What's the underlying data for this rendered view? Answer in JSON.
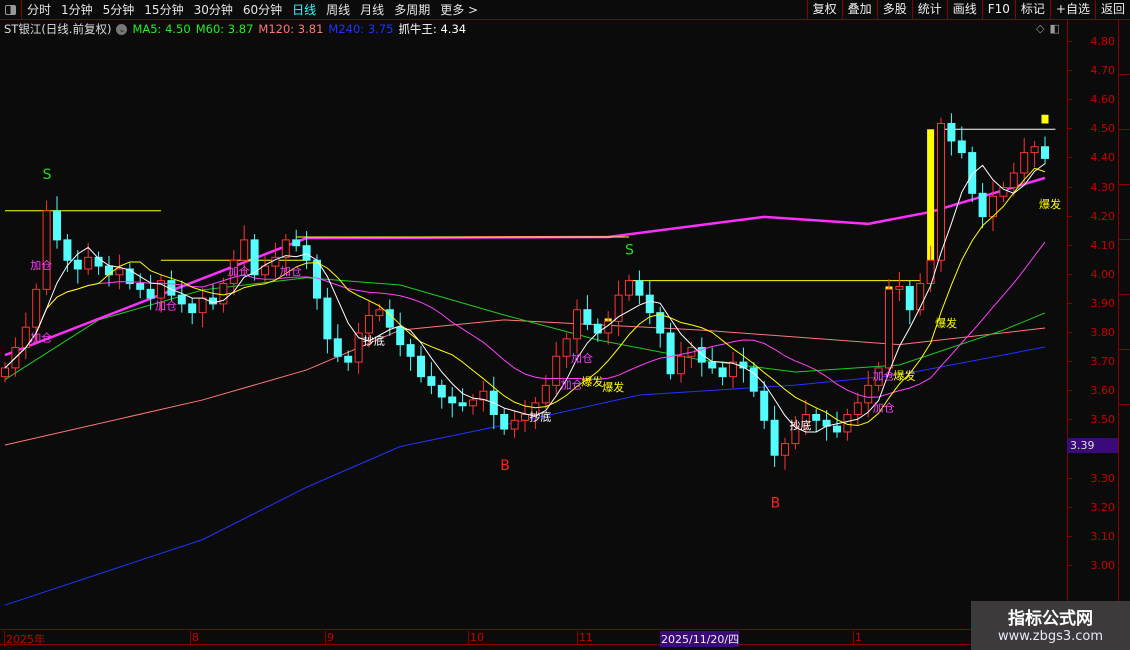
{
  "toolbar": {
    "periods": [
      "分时",
      "1分钟",
      "5分钟",
      "15分钟",
      "30分钟",
      "60分钟",
      "日线",
      "周线",
      "月线",
      "多周期",
      "更多 >"
    ],
    "active": "日线",
    "right_buttons": [
      "复权",
      "叠加",
      "多股",
      "统计",
      "画线",
      "F10",
      "标记",
      "+自选",
      "返回"
    ]
  },
  "info": {
    "title": "ST银江(日线.前复权)",
    "ma5": "MA5: 4.50",
    "m60": "M60: 3.87",
    "m120": "M120: 3.81",
    "m240": "M240: 3.75",
    "zhua": "抓牛王: 4.34"
  },
  "colors": {
    "up": "#ff3232",
    "down": "#54fcfc",
    "ma5": "#ffffff",
    "ma10": "#ffff00",
    "ma20": "#ff40ff",
    "m60": "#22cc22",
    "m120": "#ff7777",
    "m240": "#2233ff",
    "trend": "#ff30ff"
  },
  "price_axis": {
    "ticks": [
      "4.80",
      "4.70",
      "4.60",
      "4.50",
      "4.40",
      "4.30",
      "4.20",
      "4.10",
      "4.00",
      "3.90",
      "3.80",
      "3.70",
      "3.60",
      "3.50",
      "3.40",
      "3.30",
      "3.20",
      "3.10",
      "3.00"
    ],
    "current": "3.39",
    "max": 4.8,
    "min": 3.0
  },
  "date_axis": [
    "2025年",
    "8",
    "9",
    "10",
    "11",
    "2025/11/20/四",
    "1"
  ],
  "watermark": {
    "title": "指标公式网",
    "url": "www.zbgs3.com"
  },
  "chart_data": {
    "type": "candlestick",
    "closes": [
      3.68,
      3.75,
      3.82,
      3.95,
      4.22,
      4.12,
      4.05,
      4.02,
      4.06,
      4.03,
      4.0,
      4.02,
      3.97,
      3.95,
      3.92,
      3.98,
      3.93,
      3.9,
      3.87,
      3.92,
      3.9,
      3.97,
      4.05,
      4.12,
      4.0,
      4.03,
      4.06,
      4.12,
      4.1,
      4.05,
      3.92,
      3.78,
      3.72,
      3.7,
      3.8,
      3.86,
      3.88,
      3.82,
      3.76,
      3.72,
      3.65,
      3.62,
      3.58,
      3.56,
      3.55,
      3.57,
      3.6,
      3.52,
      3.47,
      3.5,
      3.52,
      3.56,
      3.62,
      3.72,
      3.78,
      3.88,
      3.83,
      3.8,
      3.84,
      3.93,
      3.98,
      3.93,
      3.87,
      3.8,
      3.66,
      3.72,
      3.75,
      3.7,
      3.68,
      3.65,
      3.7,
      3.68,
      3.6,
      3.5,
      3.38,
      3.42,
      3.48,
      3.52,
      3.5,
      3.48,
      3.46,
      3.52,
      3.56,
      3.62,
      3.68,
      3.95,
      3.96,
      3.88,
      3.97,
      4.05,
      4.52,
      4.46,
      4.42,
      4.28,
      4.2,
      4.27,
      4.3,
      4.35,
      4.42,
      4.44,
      4.4
    ],
    "lines": {
      "m240": [
        [
          0,
          2.865
        ],
        [
          19,
          3.09
        ],
        [
          29,
          3.27
        ],
        [
          38,
          3.41
        ],
        [
          48,
          3.484
        ],
        [
          61,
          3.587
        ],
        [
          76,
          3.621
        ],
        [
          86,
          3.656
        ],
        [
          100,
          3.752
        ]
      ],
      "m120": [
        [
          0,
          3.415
        ],
        [
          19,
          3.57
        ],
        [
          29,
          3.673
        ],
        [
          38,
          3.81
        ],
        [
          48,
          3.845
        ],
        [
          67,
          3.81
        ],
        [
          86,
          3.76
        ],
        [
          100,
          3.817
        ]
      ],
      "m60": [
        [
          0,
          3.64
        ],
        [
          9,
          3.845
        ],
        [
          19,
          3.948
        ],
        [
          29,
          3.99
        ],
        [
          38,
          3.965
        ],
        [
          48,
          3.862
        ],
        [
          57,
          3.776
        ],
        [
          67,
          3.707
        ],
        [
          76,
          3.666
        ],
        [
          86,
          3.69
        ],
        [
          96,
          3.81
        ],
        [
          100,
          3.869
        ]
      ],
      "trend": [
        [
          0,
          3.724
        ],
        [
          29,
          4.126
        ],
        [
          58,
          4.13
        ],
        [
          73,
          4.199
        ],
        [
          83,
          4.175
        ],
        [
          89,
          4.216
        ],
        [
          100,
          4.333
        ]
      ]
    },
    "hlines": [
      {
        "from": 0,
        "to": 15,
        "price": 4.22,
        "color": "#ffff00"
      },
      {
        "from": 15,
        "to": 29,
        "price": 4.05,
        "color": "#ffff00"
      },
      {
        "from": 28,
        "to": 60,
        "price": 4.13,
        "color": "#ffff00"
      },
      {
        "from": 60,
        "to": 88,
        "price": 3.98,
        "color": "#ffff00"
      },
      {
        "from": 90,
        "to": 101,
        "price": 4.5,
        "color": "#ffffff"
      }
    ],
    "signals": [
      {
        "i": 4,
        "text": "S",
        "price": 4.33,
        "color": "#22dd22"
      },
      {
        "i": 60,
        "text": "S",
        "price": 4.07,
        "color": "#22dd22"
      },
      {
        "i": 48,
        "text": "B",
        "price": 3.33,
        "color": "#ff2020"
      },
      {
        "i": 74,
        "text": "B",
        "price": 3.2,
        "color": "#ff2020"
      }
    ],
    "labels": [
      {
        "i": 3,
        "price": 4.02,
        "text": "加仓",
        "color": "#ff40ff"
      },
      {
        "i": 3,
        "price": 3.77,
        "text": "加仓",
        "color": "#ff40ff"
      },
      {
        "i": 15,
        "price": 3.88,
        "text": "加仓",
        "color": "#ff40ff"
      },
      {
        "i": 22,
        "price": 4.0,
        "text": "加仓",
        "color": "#ff40ff"
      },
      {
        "i": 27,
        "price": 4.0,
        "text": "加仓",
        "color": "#ff40ff"
      },
      {
        "i": 35,
        "price": 3.76,
        "text": "抄底",
        "color": "#ffffff"
      },
      {
        "i": 51,
        "price": 3.5,
        "text": "抄底",
        "color": "#ffffff"
      },
      {
        "i": 55,
        "price": 3.7,
        "text": "加仓",
        "color": "#ff40ff"
      },
      {
        "i": 54,
        "price": 3.61,
        "text": "加仓",
        "color": "#ff40ff"
      },
      {
        "i": 56,
        "price": 3.62,
        "text": "爆发",
        "color": "#ffff00"
      },
      {
        "i": 58,
        "price": 3.6,
        "text": "爆发",
        "color": "#ffff00"
      },
      {
        "i": 76,
        "price": 3.47,
        "text": "抄底",
        "color": "#ffffff"
      },
      {
        "i": 84,
        "price": 3.53,
        "text": "加仓",
        "color": "#ff40ff"
      },
      {
        "i": 84,
        "price": 3.64,
        "text": "加仓",
        "color": "#ff40ff"
      },
      {
        "i": 86,
        "price": 3.64,
        "text": "爆发",
        "color": "#ffff00"
      },
      {
        "i": 90,
        "price": 3.82,
        "text": "爆发",
        "color": "#ffff00"
      },
      {
        "i": 100,
        "price": 4.23,
        "text": "爆发",
        "color": "#ffff00"
      }
    ],
    "yellow_bars": [
      {
        "i": 89,
        "from": 4.05,
        "to": 4.5
      },
      {
        "i": 85,
        "from": 3.93,
        "to": 3.96
      },
      {
        "i": 58,
        "from": 3.81,
        "to": 3.85
      },
      {
        "i": 100,
        "from": 4.52,
        "to": 4.55
      }
    ]
  }
}
